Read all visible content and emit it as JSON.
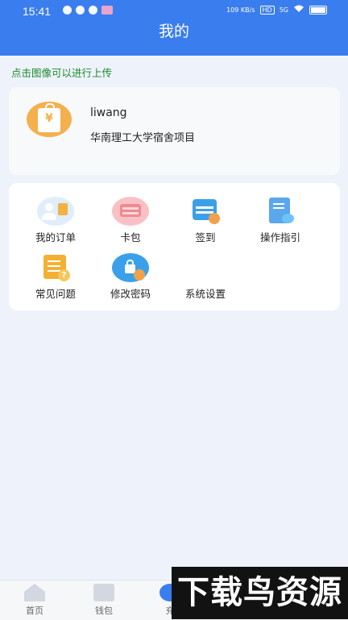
{
  "status_bar": {
    "time": "15:41",
    "network_speed": "109 KB/s",
    "hd": "HD",
    "signal": "5G",
    "icons": [
      "message-icon",
      "check-icon",
      "tiktok-icon",
      "app-icon",
      "wifi-icon",
      "battery-icon"
    ]
  },
  "header": {
    "title": "我的"
  },
  "hint": "点击图像可以进行上传",
  "profile": {
    "username": "liwang",
    "project": "华南理工大学宿舍项目",
    "avatar_icon": "shopping-bag-yen-icon"
  },
  "menu": {
    "items": [
      {
        "label": "我的订单",
        "icon": "order-icon"
      },
      {
        "label": "卡包",
        "icon": "card-wallet-icon"
      },
      {
        "label": "签到",
        "icon": "calendar-check-icon"
      },
      {
        "label": "操作指引",
        "icon": "guide-document-icon"
      },
      {
        "label": "常见问题",
        "icon": "faq-icon"
      },
      {
        "label": "修改密码",
        "icon": "lock-gear-icon"
      },
      {
        "label": "系统设置",
        "icon": ""
      }
    ]
  },
  "tabbar": {
    "items": [
      {
        "label": "首页",
        "icon": "home-icon"
      },
      {
        "label": "钱包",
        "icon": "wallet-icon"
      },
      {
        "label": "充",
        "icon": "recharge-icon"
      }
    ]
  },
  "watermark": "下载鸟资源",
  "colors": {
    "header_bg": "#3a7dee",
    "page_bg": "#eef3fb",
    "hint_text": "#1c8a2e"
  }
}
